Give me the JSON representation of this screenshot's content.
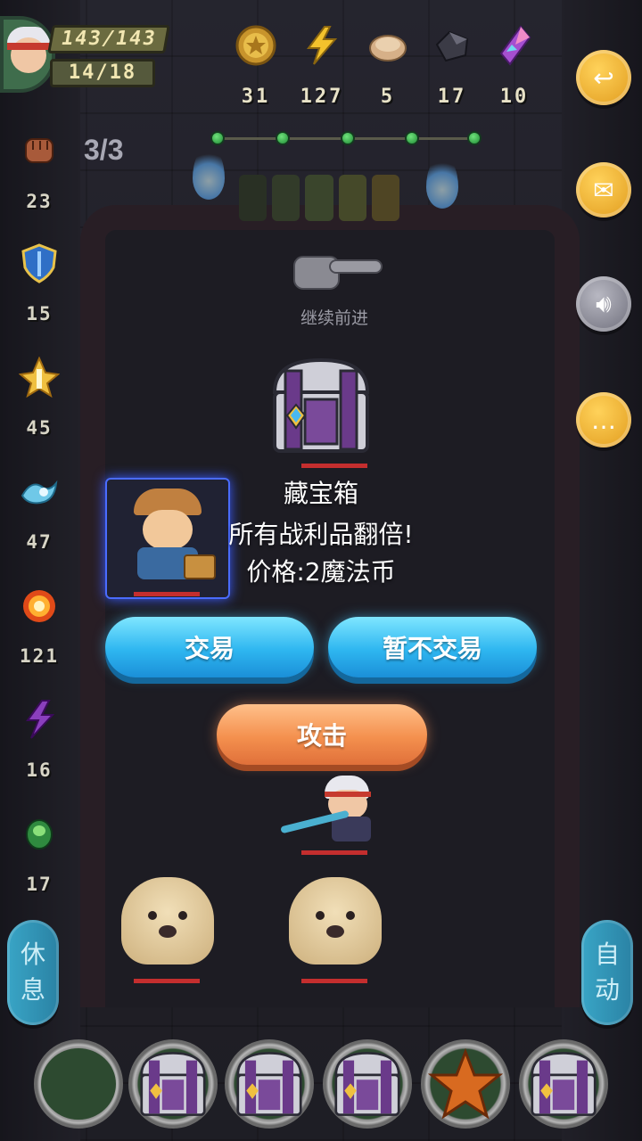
{
  "player": {
    "hp": "143/143",
    "mp": "14/18"
  },
  "resources": [
    {
      "name": "gold-coin",
      "value": "31",
      "color": "#d5a73a"
    },
    {
      "name": "lightning-energy",
      "value": "127",
      "color": "#f2c12e"
    },
    {
      "name": "bread",
      "value": "5",
      "color": "#d9b48a"
    },
    {
      "name": "iron-ore",
      "value": "17",
      "color": "#4a4a55"
    },
    {
      "name": "purple-crystal",
      "value": "10",
      "color": "#a54fd0"
    }
  ],
  "stage": {
    "count": "3/3",
    "dots": 5
  },
  "skills": [
    {
      "name": "fist-attack",
      "value": "23",
      "color": "#a85a3a"
    },
    {
      "name": "shield-defense",
      "value": "15",
      "color": "#2f6fc6"
    },
    {
      "name": "holy-power",
      "value": "45",
      "color": "#f0d060"
    },
    {
      "name": "water-wave",
      "value": "47",
      "color": "#6fc8e8"
    },
    {
      "name": "fire-ring",
      "value": "121",
      "color": "#f07a20"
    },
    {
      "name": "shadow-strike",
      "value": "16",
      "color": "#8a3fbd"
    },
    {
      "name": "poison-claw",
      "value": "17",
      "color": "#2f8a3f"
    }
  ],
  "hint": {
    "label": "继续前进"
  },
  "dialog": {
    "title": "藏宝箱",
    "description": "所有战利品翻倍!",
    "price": "价格:2魔法币",
    "trade_label": "交易",
    "decline_label": "暂不交易",
    "attack_label": "攻击"
  },
  "side_buttons": {
    "rest": "休息",
    "auto": "自动"
  },
  "colors": {
    "accent_blue": "#2eb6f0",
    "accent_orange": "#f4904e",
    "hp_red": "#c42e2e"
  }
}
